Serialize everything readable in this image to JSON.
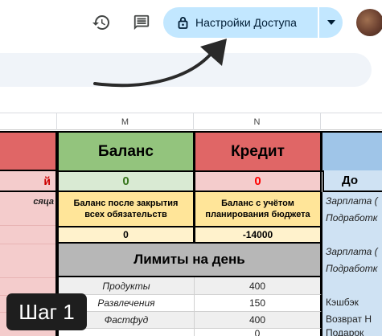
{
  "toolbar": {
    "share_label": "Настройки Доступа"
  },
  "columns": {
    "m": "M",
    "n": "N"
  },
  "cards": {
    "balance_title": "Баланс",
    "credit_title": "Кредит",
    "income_title": "До",
    "left_partial_label": "й",
    "balance_value": "0",
    "credit_value": "0"
  },
  "left_col": {
    "month_partial": "сяца"
  },
  "balance_panel": {
    "after_obligations_label": "Баланс после закрытия всех обязательств",
    "after_obligations_value": "0",
    "with_budget_label": "Баланс с учётом планирования бюджета",
    "with_budget_value": "-14000"
  },
  "limits": {
    "title": "Лимиты на день",
    "rows": [
      {
        "name": "Продукты",
        "value": "400"
      },
      {
        "name": "Развлечения",
        "value": "150"
      },
      {
        "name": "Фастфуд",
        "value": "400"
      },
      {
        "name": "",
        "value": "0"
      }
    ]
  },
  "income_list": [
    "Зарплата (",
    "Подработк",
    "Зарплата (",
    "Подработк",
    "Кэшбэк",
    "Возврат Н",
    "Подарок"
  ],
  "step": {
    "label": "Шаг 1"
  },
  "colors": {
    "share_bg": "#c2e7ff",
    "balance_green": "#93c47d",
    "credit_red": "#e06666",
    "income_blue": "#9fc5e8",
    "panel_yellow": "#ffe599",
    "limits_gray": "#b7b7b7"
  }
}
